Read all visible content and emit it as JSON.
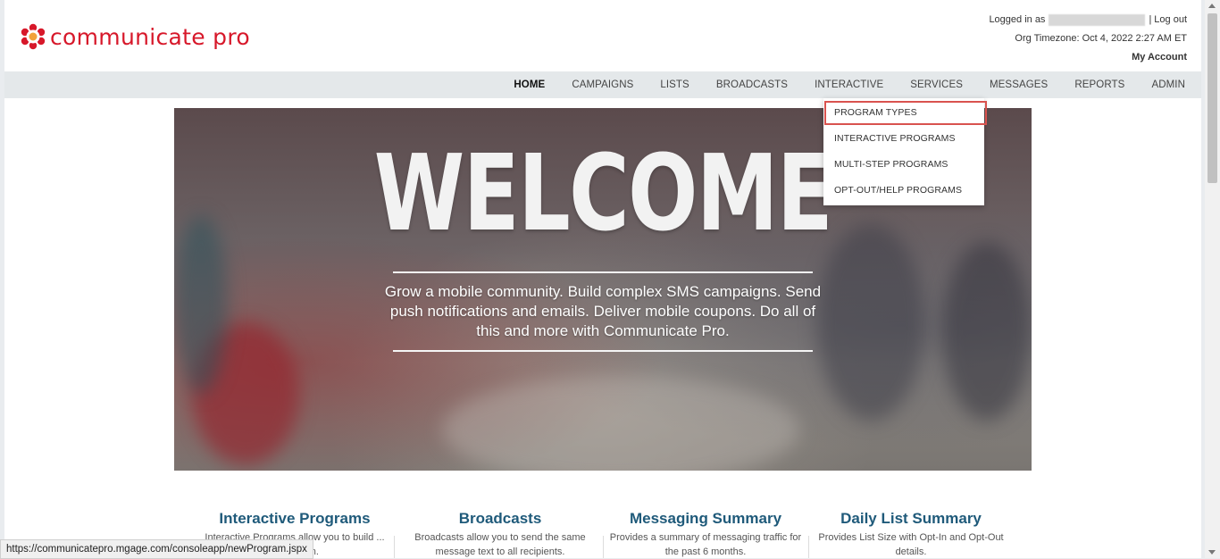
{
  "brand": {
    "name": "communicate pro",
    "accent": "#d7182a"
  },
  "header": {
    "logged_in_prefix": "Logged in as",
    "separator": "|",
    "logout": "Log out",
    "timezone": "Org Timezone: Oct 4, 2022 2:27 AM ET",
    "my_account": "My Account"
  },
  "nav": {
    "items": [
      "HOME",
      "CAMPAIGNS",
      "LISTS",
      "BROADCASTS",
      "INTERACTIVE",
      "SERVICES",
      "MESSAGES",
      "REPORTS",
      "ADMIN"
    ],
    "active": "HOME"
  },
  "dropdown": {
    "items": [
      "PROGRAM TYPES",
      "INTERACTIVE PROGRAMS",
      "MULTI-STEP PROGRAMS",
      "OPT-OUT/HELP PROGRAMS"
    ],
    "highlight_color": "#d9534f"
  },
  "hero": {
    "title": "WELCOME",
    "tagline": "Grow a mobile community. Build complex SMS campaigns. Send push notifications and emails. Deliver mobile coupons. Do all of this and more with Communicate Pro."
  },
  "sections": [
    {
      "title": "Interactive Programs",
      "desc": "Interactive Programs allow you to build ... interaction."
    },
    {
      "title": "Broadcasts",
      "desc": "Broadcasts allow you to send the same message text to all recipients."
    },
    {
      "title": "Messaging Summary",
      "desc": "Provides a summary of messaging traffic for the past 6 months."
    },
    {
      "title": "Daily List Summary",
      "desc": "Provides List Size with Opt-In and Opt-Out details."
    }
  ],
  "status_url": "https://communicatepro.mgage.com/consoleapp/newProgram.jspx"
}
